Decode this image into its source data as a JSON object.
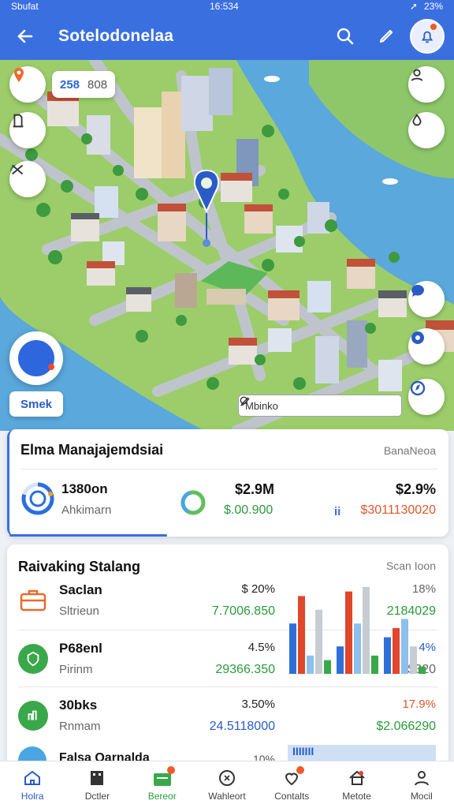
{
  "status": {
    "carrier": "Sbufat",
    "time": "16:534",
    "battery": "23%"
  },
  "header": {
    "title": "Sotelodonelaa"
  },
  "map": {
    "coord_a": "258",
    "coord_b": "808",
    "locate_label": "Smek",
    "search_value": "Mbinko",
    "colors": {
      "water": "#5aa8dc",
      "land": "#9ccd6a",
      "road": "#b9bec7",
      "pin": "#2a5cc8"
    }
  },
  "summary": {
    "title": "Elma Manajajemdsiai",
    "link": "BanaNeoa",
    "main": "1380on",
    "sub": "Ahkimarn",
    "val1": "$2.9M",
    "val1_sub": "$.00.900",
    "mini": "ii",
    "val2": "$2.9%",
    "val2_sub": "$3011130020"
  },
  "ranking": {
    "title": "Raivaking Stalang",
    "link": "Scan Ioon",
    "rows": [
      {
        "name": "Saclan",
        "sub": "Sltrieun",
        "pct": "$ 20%",
        "amt": "7.7006.850",
        "pct2": "18%",
        "amt2": "2184029"
      },
      {
        "name": "P68enl",
        "sub": "Pirinm",
        "pct": "4.5%",
        "amt": "29366.350",
        "pct2": "4%",
        "amt2": "$320"
      },
      {
        "name": "30bks",
        "sub": "Rnmam",
        "pct": "3.50%",
        "amt": "24.5118000",
        "pct2": "17.9%",
        "amt2": "$2.066290"
      }
    ],
    "partial_label": "Falsa Qarnalda",
    "partial_pct": "10%",
    "partial_text": "IIIIIII"
  },
  "bars": {
    "series": [
      {
        "color": "#2f6fd8",
        "values": [
          0.55,
          0.3,
          0.4
        ]
      },
      {
        "color": "#e0462a",
        "values": [
          0.85,
          0.9,
          0.5
        ]
      },
      {
        "color": "#8cc0ee",
        "values": [
          0.2,
          0.55,
          0.6
        ]
      },
      {
        "color": "#c7ccd3",
        "values": [
          0.7,
          0.95,
          0.3
        ]
      },
      {
        "color": "#3aa84a",
        "values": [
          0.15,
          0.2,
          0.08
        ]
      }
    ]
  },
  "nav": [
    {
      "label": "Holra",
      "icon": "home-icon",
      "active": true
    },
    {
      "label": "Dctler",
      "icon": "building-icon"
    },
    {
      "label": "Bereor",
      "icon": "briefcase-icon",
      "badge": true
    },
    {
      "label": "Wahleort",
      "icon": "clock-icon"
    },
    {
      "label": "Contalts",
      "icon": "heart-icon",
      "badge": true
    },
    {
      "label": "Metote",
      "icon": "house-icon"
    },
    {
      "label": "Mocil",
      "icon": "person-icon"
    }
  ]
}
